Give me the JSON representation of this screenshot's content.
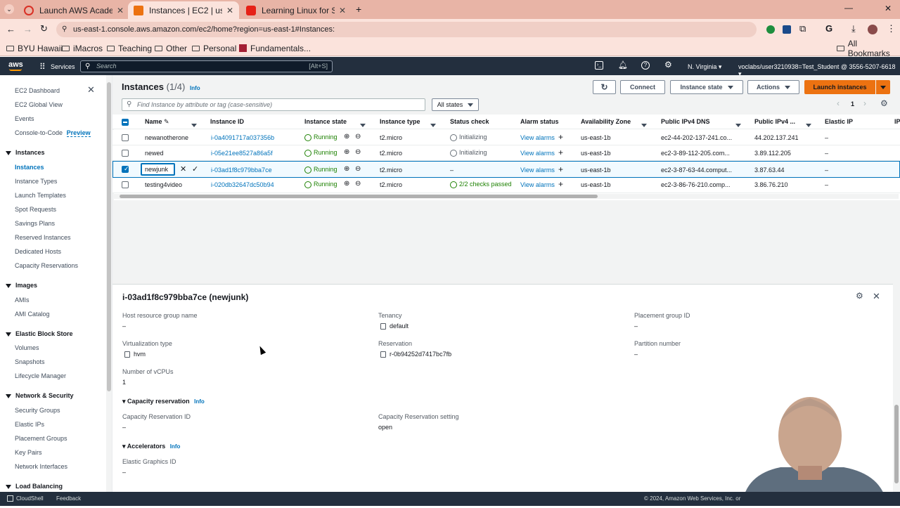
{
  "browser": {
    "tabs": [
      {
        "label": "Launch AWS Academy Le",
        "active": false
      },
      {
        "label": "Instances | EC2 | us-east",
        "active": true
      },
      {
        "label": "Learning Linux for Syste",
        "active": false
      }
    ],
    "url": "us-east-1.console.aws.amazon.com/ec2/home?region=us-east-1#Instances:",
    "bookmarks": [
      "BYU Hawaii",
      "iMacros",
      "Teaching",
      "Other",
      "Personal",
      "Fundamentals..."
    ],
    "all_bookmarks": "All Bookmarks"
  },
  "aws_header": {
    "logo": "aws",
    "services": "Services",
    "search_placeholder": "Search",
    "search_shortcut": "[Alt+S]",
    "region": "N. Virginia",
    "account": "voclabs/user3210938=Test_Student @ 3556-5207-6618"
  },
  "sidebar": {
    "top": [
      "EC2 Dashboard",
      "EC2 Global View",
      "Events",
      "Console-to-Code"
    ],
    "preview_badge": "Preview",
    "sections": [
      {
        "title": "Instances",
        "items": [
          "Instances",
          "Instance Types",
          "Launch Templates",
          "Spot Requests",
          "Savings Plans",
          "Reserved Instances",
          "Dedicated Hosts",
          "Capacity Reservations"
        ]
      },
      {
        "title": "Images",
        "items": [
          "AMIs",
          "AMI Catalog"
        ]
      },
      {
        "title": "Elastic Block Store",
        "items": [
          "Volumes",
          "Snapshots",
          "Lifecycle Manager"
        ]
      },
      {
        "title": "Network & Security",
        "items": [
          "Security Groups",
          "Elastic IPs",
          "Placement Groups",
          "Key Pairs",
          "Network Interfaces"
        ]
      },
      {
        "title": "Load Balancing",
        "items": []
      }
    ]
  },
  "instances": {
    "title": "Instances",
    "count": "(1/4)",
    "info": "Info",
    "buttons": {
      "connect": "Connect",
      "instance_state": "Instance state",
      "actions": "Actions",
      "launch": "Launch instances"
    },
    "search_placeholder": "Find Instance by attribute or tag (case-sensitive)",
    "filter_state": "All states",
    "page": "1",
    "columns": [
      "Name",
      "Instance ID",
      "Instance state",
      "Instance type",
      "Status check",
      "Alarm status",
      "Availability Zone",
      "Public IPv4 DNS",
      "Public IPv4 ...",
      "Elastic IP",
      "IP"
    ],
    "rows": [
      {
        "name": "newanotherone",
        "id": "i-0a4091717a037356b",
        "state": "Running",
        "type": "t2.micro",
        "status": "Initializing",
        "alarm": "View alarms",
        "az": "us-east-1b",
        "dns": "ec2-44-202-137-241.co...",
        "ip": "44.202.137.241",
        "eip": "–",
        "selected": false
      },
      {
        "name": "newed",
        "id": "i-05e21ee8527a86a5f",
        "state": "Running",
        "type": "t2.micro",
        "status": "Initializing",
        "alarm": "View alarms",
        "az": "us-east-1b",
        "dns": "ec2-3-89-112-205.com...",
        "ip": "3.89.112.205",
        "eip": "–",
        "selected": false
      },
      {
        "name": "newjunk",
        "id": "i-03ad1f8c979bba7ce",
        "state": "Running",
        "type": "t2.micro",
        "status": "–",
        "alarm": "View alarms",
        "az": "us-east-1b",
        "dns": "ec2-3-87-63-44.comput...",
        "ip": "3.87.63.44",
        "eip": "–",
        "selected": true
      },
      {
        "name": "testing4video",
        "id": "i-020db32647dc50b94",
        "state": "Running",
        "type": "t2.micro",
        "status": "2/2 checks passed",
        "alarm": "View alarms",
        "az": "us-east-1b",
        "dns": "ec2-3-86-76-210.comp...",
        "ip": "3.86.76.210",
        "eip": "–",
        "selected": false
      }
    ]
  },
  "detail": {
    "title": "i-03ad1f8c979bba7ce (newjunk)",
    "fields": {
      "host_group_label": "Host resource group name",
      "host_group_value": "–",
      "tenancy_label": "Tenancy",
      "tenancy_value": "default",
      "placement_label": "Placement group ID",
      "placement_value": "–",
      "virt_label": "Virtualization type",
      "virt_value": "hvm",
      "reservation_label": "Reservation",
      "reservation_value": "r-0b94252d7417bc7fb",
      "partition_label": "Partition number",
      "partition_value": "–",
      "vcpu_label": "Number of vCPUs",
      "vcpu_value": "1"
    },
    "capacity": {
      "title": "Capacity reservation",
      "info": "Info",
      "id_label": "Capacity Reservation ID",
      "id_value": "–",
      "setting_label": "Capacity Reservation setting",
      "setting_value": "open"
    },
    "accelerators": {
      "title": "Accelerators",
      "info": "Info",
      "egid_label": "Elastic Graphics ID",
      "egid_value": "–"
    }
  },
  "footer": {
    "cloudshell": "CloudShell",
    "feedback": "Feedback",
    "copyright": "© 2024, Amazon Web Services, Inc. or"
  },
  "colors": {
    "aws_header": "#232f3e",
    "accent_orange": "#ec7211",
    "link": "#0073bb",
    "running": "#1d8102"
  }
}
